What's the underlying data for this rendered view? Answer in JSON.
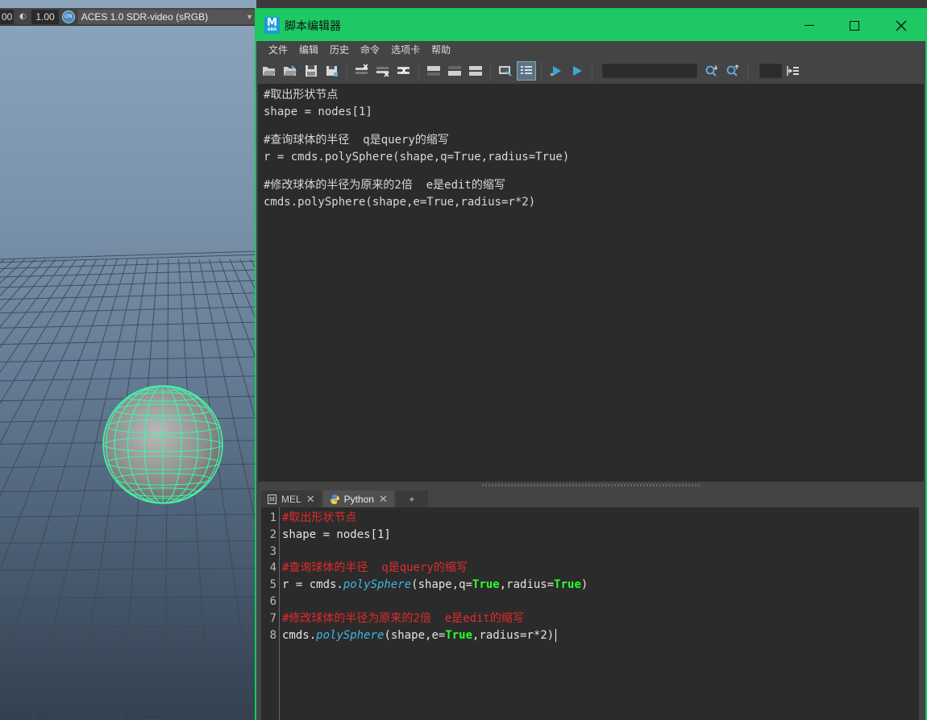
{
  "viewport": {
    "field_left": "00",
    "exposure_value": "1.00",
    "ocio_badge": "ON",
    "color_space": "ACES 1.0 SDR-video (sRGB)"
  },
  "window": {
    "title": "脚本编辑器",
    "app_icon_letter": "M",
    "app_icon_sub": "ARA"
  },
  "menu": [
    "文件",
    "编辑",
    "历史",
    "命令",
    "选项卡",
    "帮助"
  ],
  "toolbar": {
    "icons": [
      "open-script-icon",
      "source-script-icon",
      "save-script-icon",
      "save-to-shelf-icon",
      "clear-history-icon",
      "clear-input-icon",
      "clear-all-icon",
      "show-history-icon",
      "show-input-icon",
      "show-both-icon",
      "echo-all-commands-icon",
      "show-line-numbers-icon",
      "execute-all-icon",
      "execute-icon",
      "search-down-icon",
      "search-up-icon",
      "goto-line-icon"
    ]
  },
  "history": [
    "#取出形状节点",
    "shape = nodes[1]",
    "",
    "#查询球体的半径  q是query的缩写",
    "r = cmds.polySphere(shape,q=True,radius=True)",
    "",
    "#修改球体的半径为原来的2倍  e是edit的缩写",
    "cmds.polySphere(shape,e=True,radius=r*2)"
  ],
  "tabs": [
    {
      "label": "MEL",
      "close": "✕"
    },
    {
      "label": "Python",
      "close": "✕"
    },
    {
      "label": "+"
    }
  ],
  "line_numbers": [
    "1",
    "2",
    "3",
    "4",
    "5",
    "6",
    "7",
    "8"
  ],
  "code": {
    "l1_comment": "#取出形状节点",
    "l2": "shape = nodes[1]",
    "l4_comment": "#查询球体的半径  q是query的缩写",
    "l5_a": "r = cmds.",
    "l5_func": "polySphere",
    "l5_b": "(shape,q=",
    "l5_kw1": "True",
    "l5_c": ",radius=",
    "l5_kw2": "True",
    "l5_d": ")",
    "l7_comment": "#修改球体的半径为原来的2倍  e是edit的缩写",
    "l8_a": "cmds.",
    "l8_func": "polySphere",
    "l8_b": "(shape,e=",
    "l8_kw": "True",
    "l8_c": ",radius=r*2)"
  },
  "colors": {
    "title_bar": "#1ec964",
    "comment": "#e42b2b",
    "function": "#3fb6e0",
    "keyword": "#2aff2a"
  }
}
